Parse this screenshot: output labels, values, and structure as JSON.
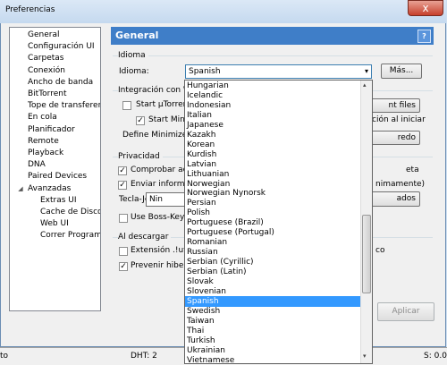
{
  "window": {
    "title": "Preferencias",
    "close_glyph": "x"
  },
  "tree": {
    "items": [
      {
        "label": "General"
      },
      {
        "label": "Configuración UI"
      },
      {
        "label": "Carpetas"
      },
      {
        "label": "Conexión"
      },
      {
        "label": "Ancho de banda"
      },
      {
        "label": "BitTorrent"
      },
      {
        "label": "Tope de transferencia"
      },
      {
        "label": "En cola"
      },
      {
        "label": "Planificador"
      },
      {
        "label": "Remote"
      },
      {
        "label": "Playback"
      },
      {
        "label": "DNA"
      },
      {
        "label": "Paired Devices"
      },
      {
        "label": "Avanzadas"
      }
    ],
    "children": [
      {
        "label": "Extras UI"
      },
      {
        "label": "Cache de Disco"
      },
      {
        "label": "Web UI"
      },
      {
        "label": "Correr Programa"
      }
    ],
    "expander_glyph": "◢"
  },
  "header": {
    "title": "General",
    "help": "?"
  },
  "idioma": {
    "group": "Idioma",
    "label": "Idioma:",
    "value": "Spanish",
    "more_button": "Más..."
  },
  "integracion": {
    "group": "Integración con Wi",
    "start_check": "Start µTorrent",
    "start_min_check": "Start Minin",
    "define_min": "Define Minimize i",
    "btn_files": "nt files",
    "btn_assoc": "ción al iniciar",
    "btn_redo": "redo"
  },
  "privacidad": {
    "group": "Privacidad",
    "check_upd": "Comprobar actu",
    "check_send": "Enviar informac",
    "right_eta": "eta",
    "right_anon": "nimamente)",
    "bosskey_label": "Tecla-Jefe",
    "bosskey_value": "Nin",
    "btn_avanzados": "ados",
    "bosskey_pass": "Use Boss-Key pa"
  },
  "descargar": {
    "group": "Al descargar",
    "ext_check": "Extensión .!ut a",
    "right_co": "co",
    "prevent_check": "Prevenir hiberna"
  },
  "buttons": {
    "apply": "Aplicar"
  },
  "status": {
    "left": "to",
    "dht": "DHT: 2",
    "right": "S: 0.0"
  },
  "languages": [
    "Hungarian",
    "Icelandic",
    "Indonesian",
    "Italian",
    "Japanese",
    "Kazakh",
    "Korean",
    "Kurdish",
    "Latvian",
    "Lithuanian",
    "Norwegian",
    "Norwegian Nynorsk",
    "Persian",
    "Polish",
    "Portuguese (Brazil)",
    "Portuguese (Portugal)",
    "Romanian",
    "Russian",
    "Serbian (Cyrillic)",
    "Serbian (Latin)",
    "Slovak",
    "Slovenian",
    "Spanish",
    "Swedish",
    "Taiwan",
    "Thai",
    "Turkish",
    "Ukrainian",
    "Vietnamese"
  ],
  "selected_language_index": 22,
  "glyphs": {
    "check": "✓",
    "arrow_down": "▾",
    "arrow_up": "▴"
  }
}
